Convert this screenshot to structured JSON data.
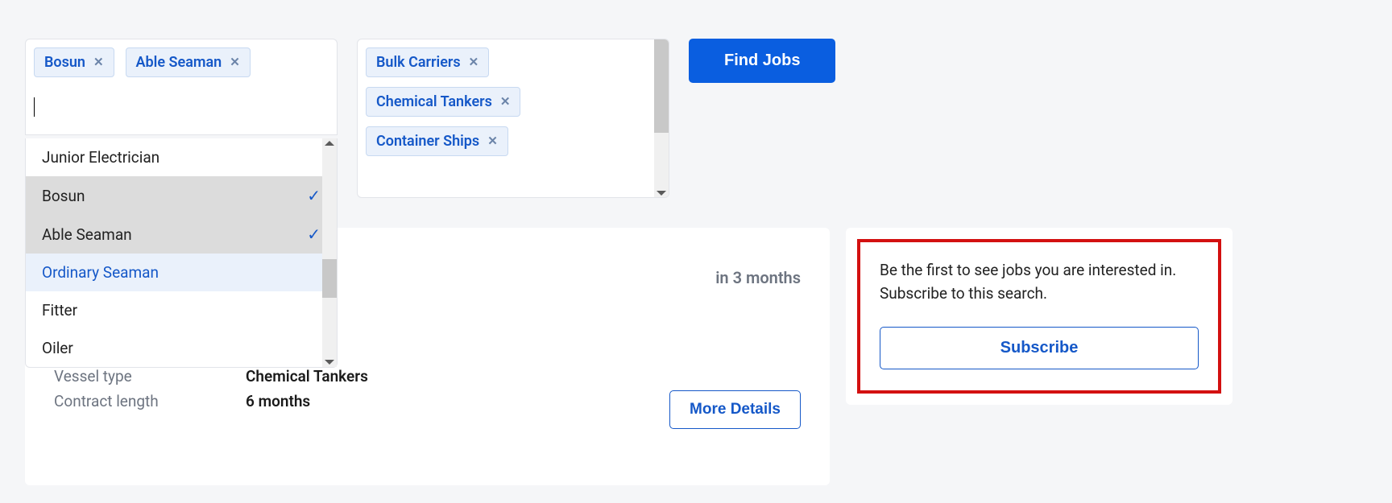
{
  "filters": {
    "rank": {
      "selected": [
        {
          "label": "Bosun"
        },
        {
          "label": "Able Seaman"
        }
      ],
      "options": [
        {
          "label": "Junior Electrician",
          "selected": false,
          "highlight": false
        },
        {
          "label": "Bosun",
          "selected": true,
          "highlight": false
        },
        {
          "label": "Able Seaman",
          "selected": true,
          "highlight": false
        },
        {
          "label": "Ordinary Seaman",
          "selected": false,
          "highlight": true
        },
        {
          "label": "Fitter",
          "selected": false,
          "highlight": false
        },
        {
          "label": "Oiler",
          "selected": false,
          "highlight": false
        }
      ]
    },
    "vessel": {
      "selected": [
        {
          "label": "Bulk Carriers"
        },
        {
          "label": "Chemical Tankers"
        },
        {
          "label": "Container Ships"
        }
      ]
    },
    "submit_label": "Find Jobs"
  },
  "job": {
    "timing": "in 3 months",
    "partial_value": "2",
    "vessel_type_label": "Vessel type",
    "vessel_type_value": "Chemical Tankers",
    "contract_label": "Contract length",
    "contract_value": "6 months",
    "more_label": "More Details"
  },
  "subscribe": {
    "text": "Be the first to see jobs you are interested in. Subscribe to this search.",
    "button": "Subscribe"
  }
}
